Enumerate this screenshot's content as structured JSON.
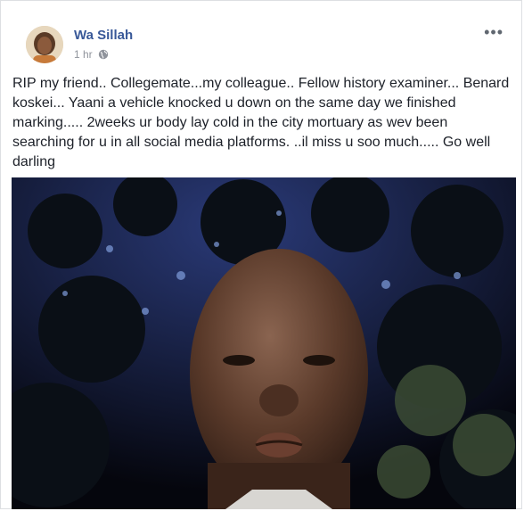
{
  "post": {
    "author": "Wa Sillah",
    "time": "1 hr",
    "privacy_icon": "globe-icon",
    "more_label": "•••",
    "text": "RIP my friend.. Collegemate...my colleague.. Fellow history examiner... Benard koskei... Yaani a vehicle knocked u down on the same day we finished marking..... 2weeks ur body lay cold in the city mortuary as wev been searching for u in all social media platforms. ..il miss u soo much..... Go well darling"
  },
  "colors": {
    "author": "#385898",
    "meta": "#90949c",
    "text": "#1d2129"
  }
}
